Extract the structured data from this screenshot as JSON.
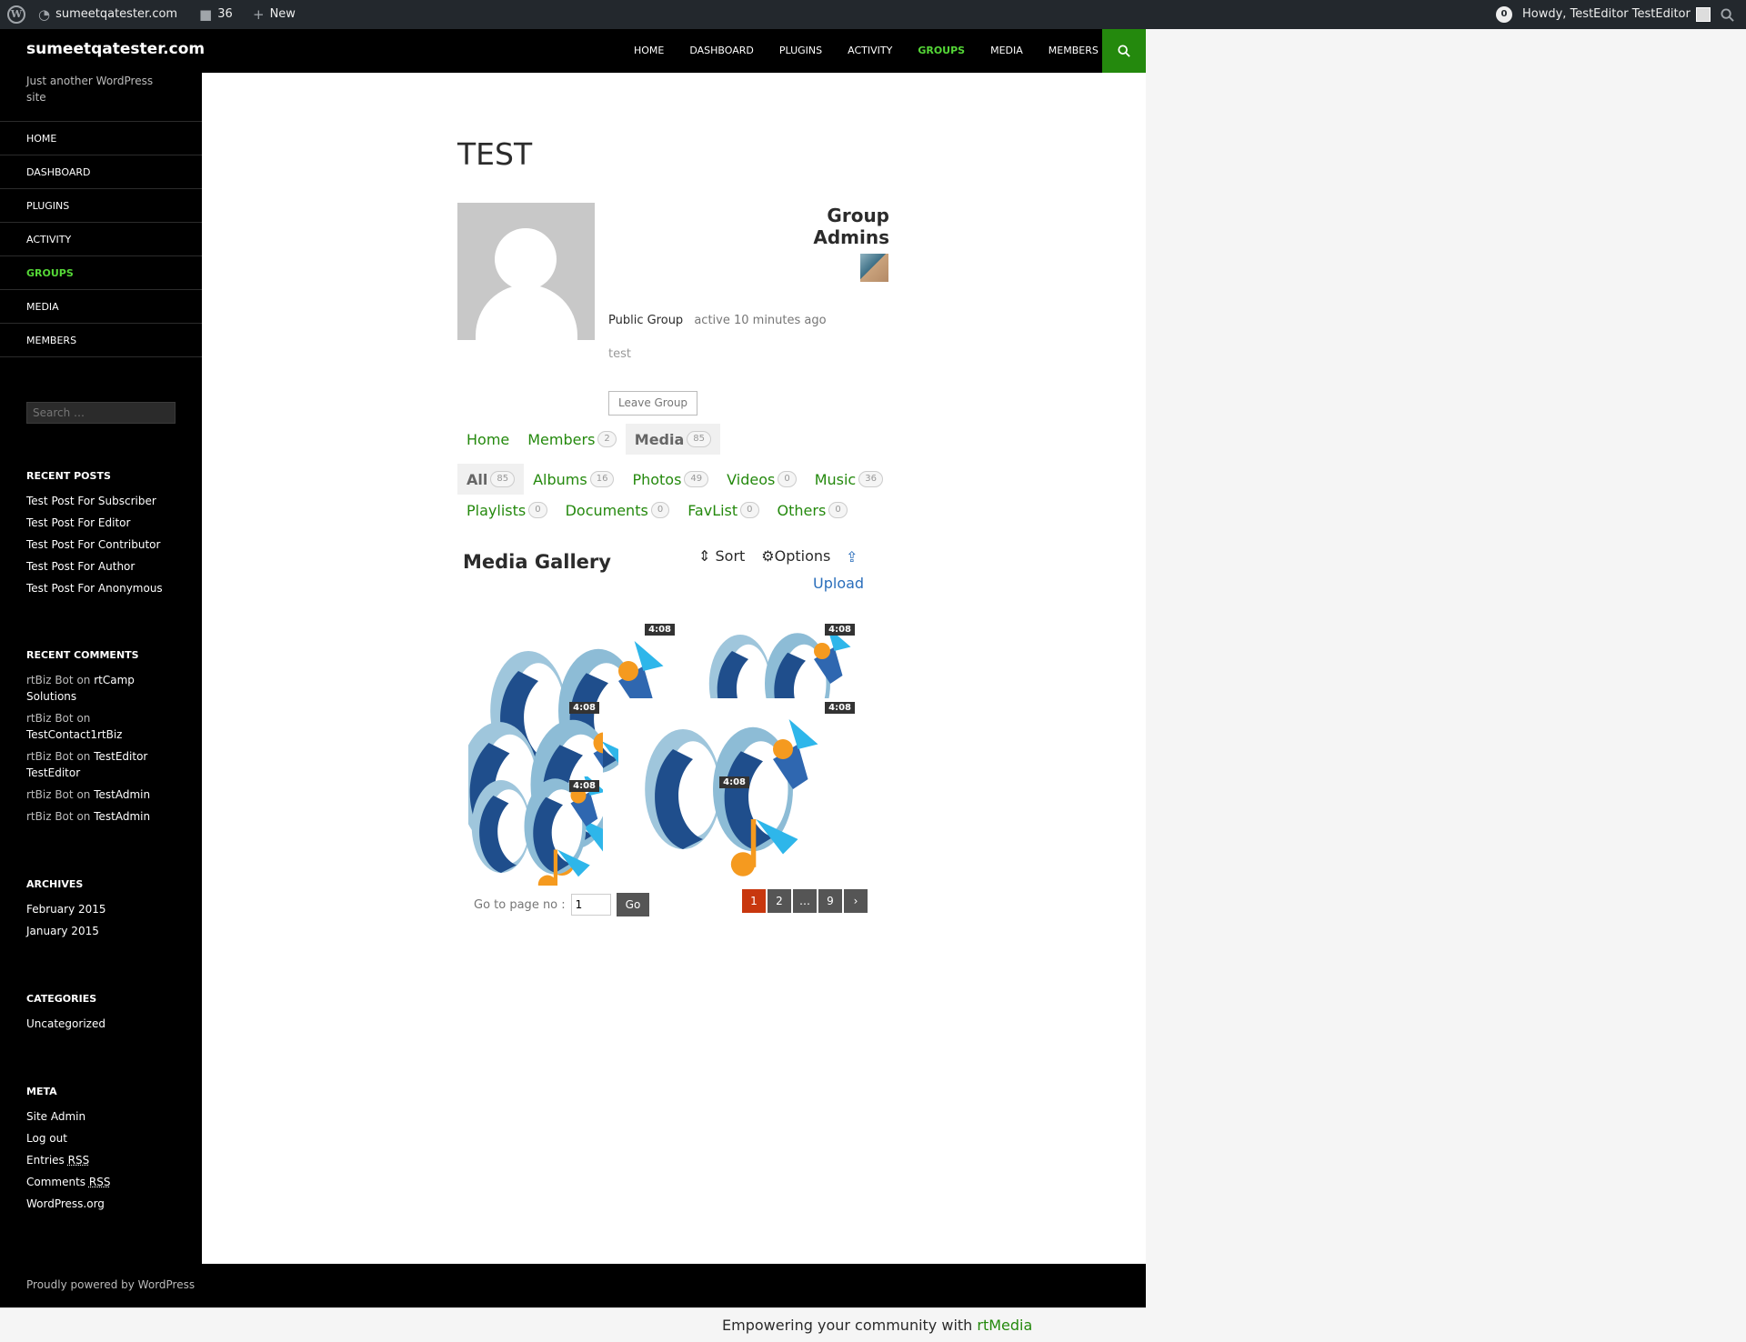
{
  "adminbar": {
    "site": "sumeetqatester.com",
    "comments": "36",
    "new": "New",
    "notif": "0",
    "howdy": "Howdy, TestEditor TestEditor"
  },
  "header": {
    "site_title": "sumeetqatester.com",
    "tagline": "Just another WordPress site",
    "nav": [
      "HOME",
      "DASHBOARD",
      "PLUGINS",
      "ACTIVITY",
      "GROUPS",
      "MEDIA",
      "MEMBERS"
    ],
    "active": "GROUPS"
  },
  "sidebar": {
    "nav": [
      "HOME",
      "DASHBOARD",
      "PLUGINS",
      "ACTIVITY",
      "GROUPS",
      "MEDIA",
      "MEMBERS"
    ],
    "search_placeholder": "Search …",
    "recent_posts_title": "RECENT POSTS",
    "recent_posts": [
      "Test Post For Subscriber",
      "Test Post For Editor",
      "Test Post For Contributor",
      "Test Post For Author",
      "Test Post For Anonymous"
    ],
    "recent_comments_title": "RECENT COMMENTS",
    "recent_comments": [
      {
        "author": "rtBiz Bot",
        "on": "on",
        "target": "rtCamp Solutions"
      },
      {
        "author": "rtBiz Bot",
        "on": "on",
        "target": "TestContact1rtBiz"
      },
      {
        "author": "rtBiz Bot",
        "on": "on",
        "target": "TestEditor TestEditor"
      },
      {
        "author": "rtBiz Bot",
        "on": "on",
        "target": "TestAdmin"
      },
      {
        "author": "rtBiz Bot",
        "on": "on",
        "target": "TestAdmin"
      }
    ],
    "archives_title": "ARCHIVES",
    "archives": [
      "February 2015",
      "January 2015"
    ],
    "categories_title": "CATEGORIES",
    "categories": [
      "Uncategorized"
    ],
    "meta_title": "META",
    "meta": {
      "site_admin": "Site Admin",
      "log_out": "Log out",
      "entries": "Entries",
      "comments": "Comments",
      "rss": "RSS",
      "wordpress": "WordPress.org"
    }
  },
  "group": {
    "title": "TEST",
    "admins_title": "Group Admins",
    "type": "Public Group",
    "activity": "active 10 minutes ago",
    "description": "test",
    "leave_button": "Leave Group"
  },
  "tabs": [
    {
      "label": "Home",
      "count": ""
    },
    {
      "label": "Members",
      "count": "2"
    },
    {
      "label": "Media",
      "count": "85"
    }
  ],
  "media_tabs_row1": [
    {
      "label": "All",
      "count": "85"
    },
    {
      "label": "Albums",
      "count": "16"
    },
    {
      "label": "Photos",
      "count": "49"
    },
    {
      "label": "Videos",
      "count": "0"
    },
    {
      "label": "Music",
      "count": "36"
    }
  ],
  "media_tabs_row2": [
    {
      "label": "Playlists",
      "count": "0"
    },
    {
      "label": "Documents",
      "count": "0"
    },
    {
      "label": "FavList",
      "count": "0"
    },
    {
      "label": "Others",
      "count": "0"
    }
  ],
  "gallery": {
    "title": "Media Gallery",
    "sort": "Sort",
    "options": "Options",
    "upload": "Upload",
    "duration": "4:08",
    "goto_label": "Go to page no :",
    "goto_value": "1",
    "go_button": "Go",
    "pages": [
      "1",
      "2",
      "…",
      "9",
      "›"
    ]
  },
  "footer": {
    "powered": "Proudly powered by WordPress",
    "empower_text": "Empowering your community with",
    "empower_brand": "rtMedia"
  },
  "colors": {
    "accent_green": "#24890d",
    "active_green": "#55d737",
    "current_page": "#c8370e"
  }
}
